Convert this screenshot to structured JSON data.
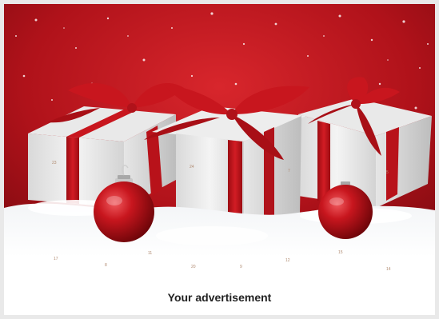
{
  "advertisement": {
    "caption": "Your advertisement",
    "image_alt": "Advent calendar with white gift boxes, red ribbons and red baubles in snow"
  },
  "calendar_days": [
    "24",
    "23",
    "7",
    "5",
    "17",
    "8",
    "11",
    "20",
    "9",
    "12",
    "15",
    "14"
  ],
  "colors": {
    "background_red": "#b0121a",
    "ribbon_red": "#c8161e",
    "box_white": "#f2f2f2",
    "snow": "#ffffff",
    "page_bg": "#e9e9e9"
  }
}
